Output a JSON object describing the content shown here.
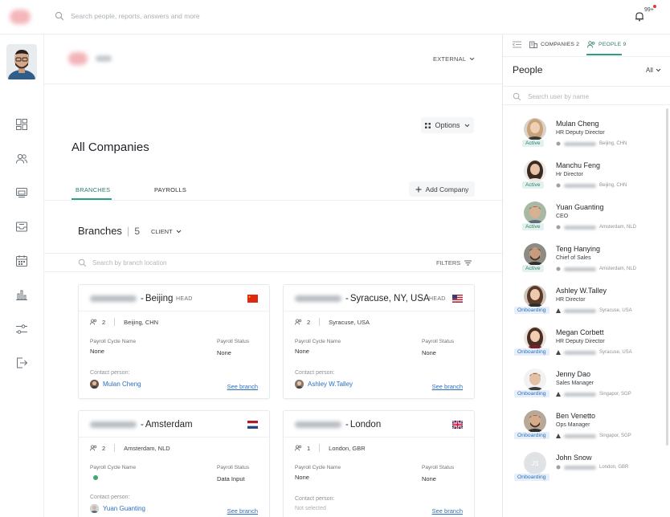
{
  "topbar": {
    "search_placeholder": "Search people, reports, answers and more",
    "notifications_badge": "99+"
  },
  "header": {
    "external_label": "EXTERNAL"
  },
  "main": {
    "options_label": "Options",
    "title": "All Companies",
    "tabs": [
      {
        "label": "BRANCHES",
        "active": true
      },
      {
        "label": "PAYROLLS",
        "active": false
      }
    ],
    "add_company_label": "Add Company",
    "branches_label": "Branches",
    "branches_count": "5",
    "client_label": "CLIENT",
    "branch_search_placeholder": "Search by branch location",
    "filters_label": "FILTERS"
  },
  "branches": [
    {
      "city": "Beijing",
      "tag": "HEAD",
      "flag": "CN",
      "people": "2",
      "location": "Beijing, CHN",
      "cycle_label": "Payroll Cycle Name",
      "cycle_value": "None",
      "status_label": "Payroll Status",
      "status_value": "None",
      "contact_label": "Contact person:",
      "contact_name": "Mulan Cheng",
      "see": "See branch"
    },
    {
      "city": "Syracuse, NY, USA",
      "tag": "HEAD",
      "flag": "US",
      "people": "2",
      "location": "Syracuse, USA",
      "cycle_label": "Payroll Cycle Name",
      "cycle_value": "None",
      "status_label": "Payroll Status",
      "status_value": "None",
      "contact_label": "Contact person:",
      "contact_name": "Ashley W.Talley",
      "see": "See branch"
    },
    {
      "city": "Amsterdam",
      "tag": "",
      "flag": "NL",
      "people": "2",
      "location": "Amsterdam, NLD",
      "cycle_label": "Payroll Cycle Name",
      "cycle_value": "",
      "status_label": "Payroll Status",
      "status_value": "Data Input",
      "contact_label": "Contact person:",
      "contact_name": "Yuan Guanting",
      "see": "See branch"
    },
    {
      "city": "London",
      "tag": "",
      "flag": "GB",
      "people": "1",
      "location": "London, GBR",
      "cycle_label": "Payroll Cycle Name",
      "cycle_value": "None",
      "status_label": "Payroll Status",
      "status_value": "None",
      "contact_label": "Contact person:",
      "contact_name": "Not selected",
      "see": "See branch"
    }
  ],
  "right_panel": {
    "tab_companies": "COMPANIES 2",
    "tab_people": "PEOPLE 9",
    "title": "People",
    "filter_label": "All",
    "search_placeholder": "Search user by name",
    "people": [
      {
        "name": "Mulan Cheng",
        "role": "HR Deputy Director",
        "status": "Active",
        "location": "Beijing, CHN"
      },
      {
        "name": "Manchu Feng",
        "role": "Hr Director",
        "status": "Active",
        "location": "Beijing, CHN"
      },
      {
        "name": "Yuan Guanting",
        "role": "CEO",
        "status": "Active",
        "location": "Amsterdam, NLD"
      },
      {
        "name": "Teng Hanying",
        "role": "Chief of Sales",
        "status": "Active",
        "location": "Amsterdam, NLD"
      },
      {
        "name": "Ashley W.Talley",
        "role": "HR Director",
        "status": "Onboarding",
        "location": "Syracuse, USA"
      },
      {
        "name": "Megan Corbett",
        "role": "HR Deputy Director",
        "status": "Onboarding",
        "location": "Syracuse, USA"
      },
      {
        "name": "Jenny Dao",
        "role": "Sales Manager",
        "status": "Onboarding",
        "location": "Singapor, SGP"
      },
      {
        "name": "Ben Venetto",
        "role": "Ops Manager",
        "status": "Onboarding",
        "location": "Singapor, SGP"
      },
      {
        "name": "John Snow",
        "role": "",
        "status": "Onboarding",
        "location": "London, GBR",
        "initials": "JS"
      }
    ]
  },
  "colors": {
    "accent": "#2e9c86",
    "link": "#2a6fbf",
    "active_badge_bg": "#e4f2ee",
    "onboarding_badge_bg": "#e6eff8"
  }
}
